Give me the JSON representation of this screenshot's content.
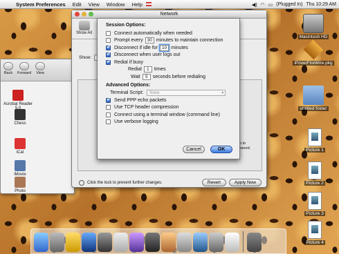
{
  "menubar": {
    "app": "System Preferences",
    "items": [
      "Edit",
      "View",
      "Window",
      "Help"
    ],
    "status": "(Plugged In)",
    "clock": "Thu 10:29 AM"
  },
  "desktop": [
    "Macintosh HD",
    "iPoverFireWire.pkg",
    "untitled folder",
    "Picture 1",
    "Picture 2",
    "Picture 3",
    "Picture 4"
  ],
  "finder": {
    "back": "Back",
    "forward": "Forward",
    "view": "View",
    "items": [
      "Acrobat Reader 5.0",
      "Chess",
      "iCal",
      "iMovie",
      "Photo"
    ]
  },
  "pref": {
    "title": "Network",
    "show_all": "Show All",
    "show_label": "Show:",
    "peek": "p to\nsword.",
    "lock_text": "Click the lock to prevent further changes.",
    "revert": "Revert",
    "apply": "Apply Now"
  },
  "sheet": {
    "session_title": "Session Options:",
    "connect_auto": "Connect automatically when needed",
    "prompt_pre": "Prompt every",
    "prompt_val": "30",
    "prompt_post": "minutes to maintain connection",
    "disc_idle_pre": "Disconnect if idle for",
    "disc_idle_val": "10",
    "disc_idle_post": "minutes",
    "disc_logout": "Disconnect when user logs out",
    "redial": "Redial if busy",
    "redial_label": "Redial",
    "redial_val": "1",
    "redial_post": "times",
    "wait_label": "Wait",
    "wait_val": "5",
    "wait_post": "seconds before redialing",
    "advanced_title": "Advanced Options:",
    "terminal_label": "Terminal Script:",
    "terminal_val": "None",
    "ppp_echo": "Send PPP echo packets",
    "tcp": "Use TCP header compression",
    "term_window": "Connect using a terminal window (command line)",
    "verbose": "Use verbose logging",
    "cancel": "Cancel",
    "ok": "OK"
  }
}
